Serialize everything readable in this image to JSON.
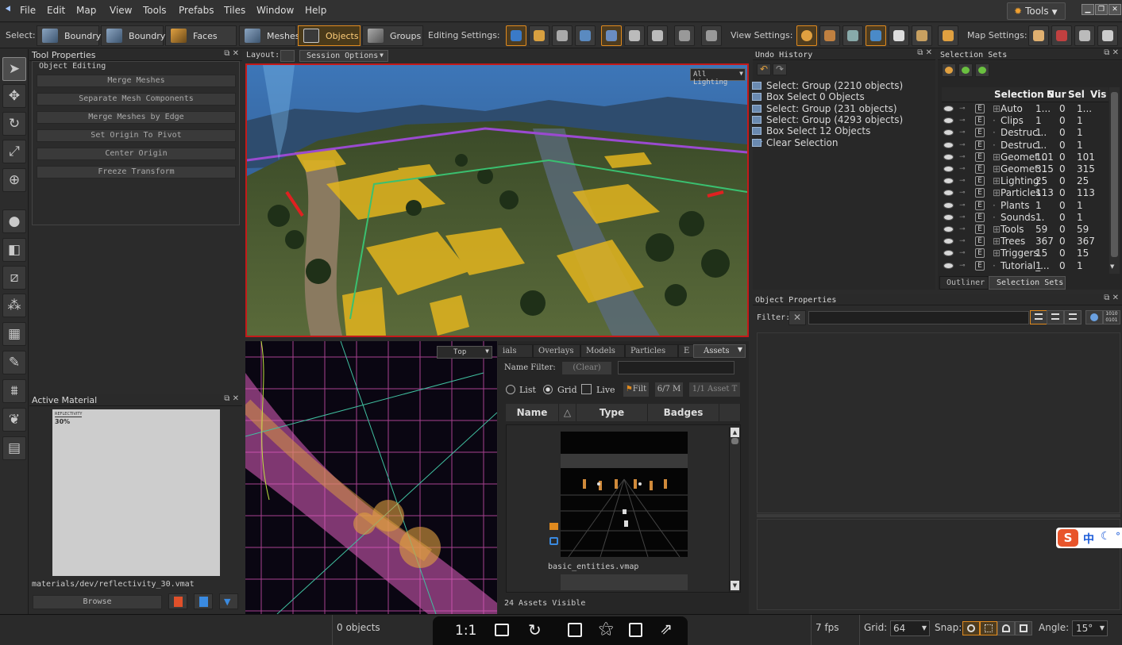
{
  "menu": {
    "items": [
      "File",
      "Edit",
      "Map",
      "View",
      "Tools",
      "Prefabs",
      "Tiles",
      "Window",
      "Help"
    ],
    "tools_button": "Tools"
  },
  "toolbar": {
    "select_label": "Select:",
    "select_buttons": [
      "Boundry",
      "Boundry",
      "Faces",
      "Meshes",
      "Objects",
      "Groups"
    ],
    "active_select": "Objects",
    "editing_label": "Editing Settings:",
    "view_label": "View Settings:",
    "map_label": "Map Settings:"
  },
  "tool_properties": {
    "title": "Tool Properties",
    "group": "Object Editing",
    "buttons": [
      "Merge Meshes",
      "Separate Mesh Components",
      "Merge Meshes by Edge",
      "Set Origin To Pivot",
      "Center Origin",
      "Freeze Transform"
    ]
  },
  "active_material": {
    "title": "Active Material",
    "swatch_title": "REFLECTIVITY",
    "swatch_value": "30%",
    "path": "materials/dev/reflectivity_30.vmat",
    "browse": "Browse"
  },
  "layout": {
    "label": "Layout:",
    "session_options": "Session Options"
  },
  "viewport_top": {
    "mode": "All Lighting"
  },
  "viewport_bottom": {
    "mode": "Top"
  },
  "undo": {
    "title": "Undo History",
    "entries": [
      "Select: Group (2210 objects)",
      "Box Select 0 Objects",
      "Select: Group (231 objects)",
      "Select: Group (4293 objects)",
      "Box Select 12 Objects",
      "Clear Selection"
    ]
  },
  "selection_sets": {
    "title": "Selection Sets",
    "columns": [
      "Selection S",
      "Nur",
      "Sel",
      "Vis"
    ],
    "rows": [
      {
        "name": "Auto",
        "num": "1...",
        "sel": "0",
        "vis": "1...",
        "expand": true
      },
      {
        "name": "Clips",
        "num": "1",
        "sel": "0",
        "vis": "1",
        "expand": false
      },
      {
        "name": "Destruc...",
        "num": "1",
        "sel": "0",
        "vis": "1",
        "expand": false
      },
      {
        "name": "Destruc...",
        "num": "1",
        "sel": "0",
        "vis": "1",
        "expand": false
      },
      {
        "name": "Geomet...",
        "num": "101",
        "sel": "0",
        "vis": "101",
        "expand": true
      },
      {
        "name": "Geomet...",
        "num": "315",
        "sel": "0",
        "vis": "315",
        "expand": true
      },
      {
        "name": "Lighting",
        "num": "25",
        "sel": "0",
        "vis": "25",
        "expand": true
      },
      {
        "name": "Particles",
        "num": "113",
        "sel": "0",
        "vis": "113",
        "expand": true
      },
      {
        "name": "Plants",
        "num": "1",
        "sel": "0",
        "vis": "1",
        "expand": false
      },
      {
        "name": "Sounds...",
        "num": "1",
        "sel": "0",
        "vis": "1",
        "expand": false
      },
      {
        "name": "Tools",
        "num": "59",
        "sel": "0",
        "vis": "59",
        "expand": true
      },
      {
        "name": "Trees",
        "num": "367",
        "sel": "0",
        "vis": "367",
        "expand": true
      },
      {
        "name": "Triggers",
        "num": "15",
        "sel": "0",
        "vis": "15",
        "expand": true
      },
      {
        "name": "Tutorial_...",
        "num": "1",
        "sel": "0",
        "vis": "1",
        "expand": false
      }
    ],
    "tabs": [
      "Outliner",
      "Selection Sets"
    ]
  },
  "object_properties": {
    "title": "Object Properties",
    "filter_label": "Filter:"
  },
  "asset_browser": {
    "tabs": [
      "ials",
      "Overlays",
      "Models",
      "Particles",
      "E"
    ],
    "assets_dropdown": "Assets",
    "name_filter_label": "Name Filter:",
    "clear": "(Clear)",
    "view_list": "List",
    "view_grid": "Grid",
    "live": "Live",
    "filt": "Filt",
    "count1": "6/7 M",
    "count2": "1/1 Asset T",
    "headers": [
      "Name",
      "Type",
      "Badges"
    ],
    "asset_name": "basic_entities.vmap",
    "footer": "24 Assets Visible"
  },
  "status": {
    "objects": "0 objects",
    "ratio": "1:1",
    "fps": "7 fps",
    "grid_label": "Grid:",
    "grid_value": "64",
    "snap_label": "Snap:",
    "angle_label": "Angle:",
    "angle_value": "15°"
  },
  "ime": {
    "label": "中"
  }
}
